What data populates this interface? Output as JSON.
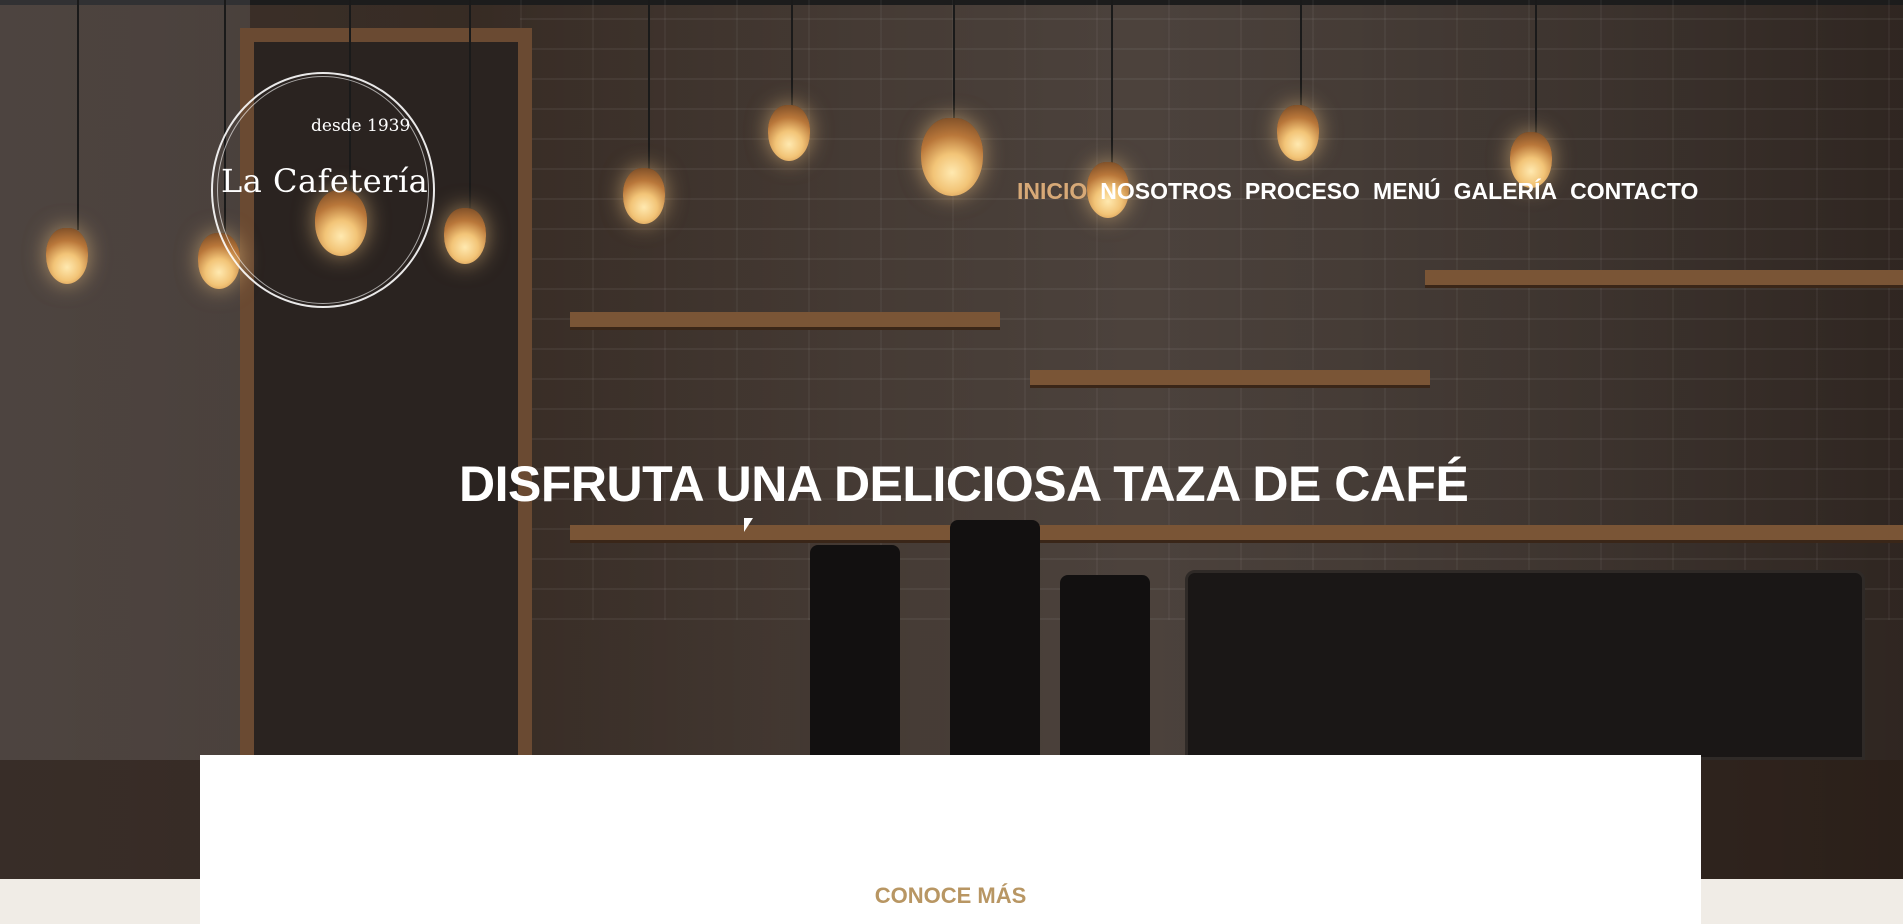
{
  "logo": {
    "since": "desde 1939",
    "name": "La Cafetería"
  },
  "nav": {
    "items": [
      "INICIO",
      "NOSOTROS",
      "PROCESO",
      "MENÚ",
      "GALERÍA",
      "CONTACTO"
    ],
    "active": "INICIO"
  },
  "hero": {
    "headline": "DISFRUTA UNA DELICIOSA TAZA DE CAFÉ"
  },
  "section": {
    "learn_more": "CONOCE MÁS"
  },
  "colors": {
    "accent": "#d7a977",
    "section_heading": "#b89663",
    "page_background": "#f0ece6"
  }
}
